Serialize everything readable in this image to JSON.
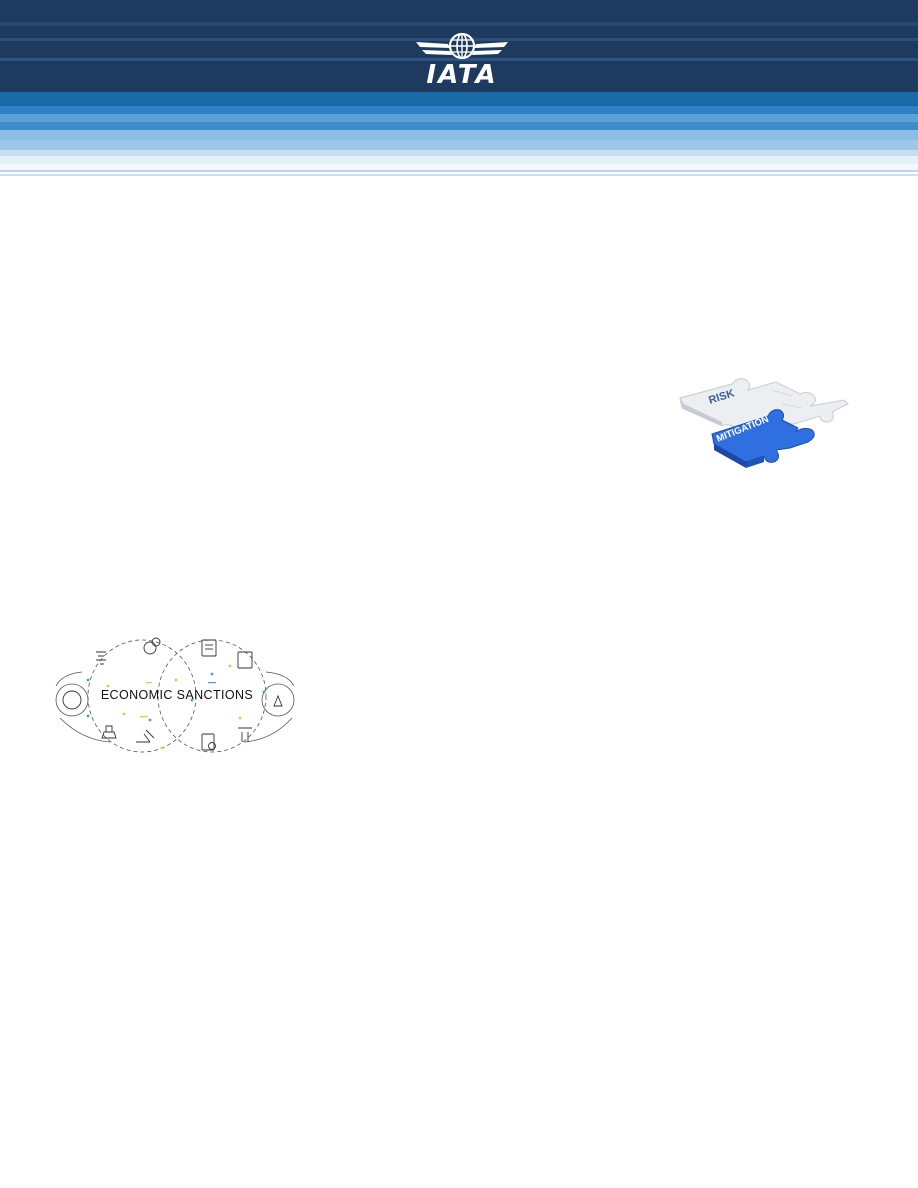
{
  "header": {
    "logo_text": "IATA",
    "colors": {
      "navy": "#1b3555",
      "blue": "#2a5a8c",
      "light_blue": "#8fbde0",
      "pale_blue": "#d8e9f6"
    }
  },
  "images": {
    "puzzle": {
      "top_piece_text": "RISK",
      "bottom_piece_text": "MITIGATION",
      "accent": "#2f6fe0"
    },
    "sanctions": {
      "title": "ECONOMIC SANCTIONS",
      "accent_yellow": "#f2c230",
      "accent_blue": "#3aa0e8"
    }
  }
}
